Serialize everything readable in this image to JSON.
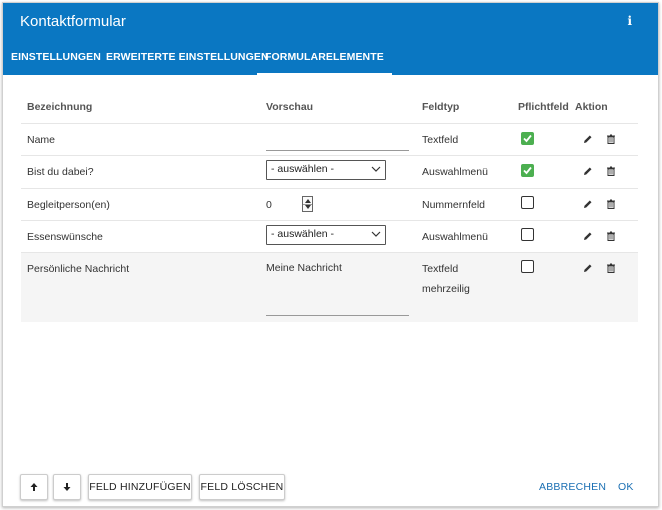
{
  "dialog": {
    "title": "Kontaktformular",
    "info_icon": "i"
  },
  "tabs": [
    {
      "label": "EINSTELLUNGEN"
    },
    {
      "label": "ERWEITERTE EINSTELLUNGEN"
    },
    {
      "label": "FORMULARELEMENTE",
      "active": true
    }
  ],
  "table": {
    "headers": {
      "name": "Bezeichnung",
      "preview": "Vorschau",
      "type": "Feldtyp",
      "required": "Pflichtfeld",
      "action": "Aktion"
    },
    "rows": [
      {
        "name": "Name",
        "preview_kind": "text",
        "type": "Textfeld",
        "required": true
      },
      {
        "name": "Bist du dabei?",
        "preview_kind": "select",
        "preview_value": "- auswählen -",
        "type": "Auswahlmenü",
        "required": true
      },
      {
        "name": "Begleitperson(en)",
        "preview_kind": "number",
        "preview_value": "0",
        "type": "Nummernfeld",
        "required": false
      },
      {
        "name": "Essenswünsche",
        "preview_kind": "select",
        "preview_value": "- auswählen -",
        "type": "Auswahlmenü",
        "required": false
      },
      {
        "name": "Persönliche Nachricht",
        "preview_kind": "textarea",
        "preview_value": "Meine Nachricht",
        "type_line1": "Textfeld",
        "type_line2": "mehrzeilig",
        "required": false
      }
    ]
  },
  "footer": {
    "add_label": "FELD HINZUFÜGEN",
    "delete_label": "FELD LÖSCHEN",
    "cancel_label": "ABBRECHEN",
    "ok_label": "OK"
  },
  "colors": {
    "header": "#0a77c2",
    "check_green": "#4caf50",
    "link": "#1a6fb3"
  },
  "icons": {
    "up": "arrow-up-icon",
    "down": "arrow-down-icon",
    "edit": "pencil-icon",
    "delete": "trash-icon",
    "info": "info-icon"
  }
}
